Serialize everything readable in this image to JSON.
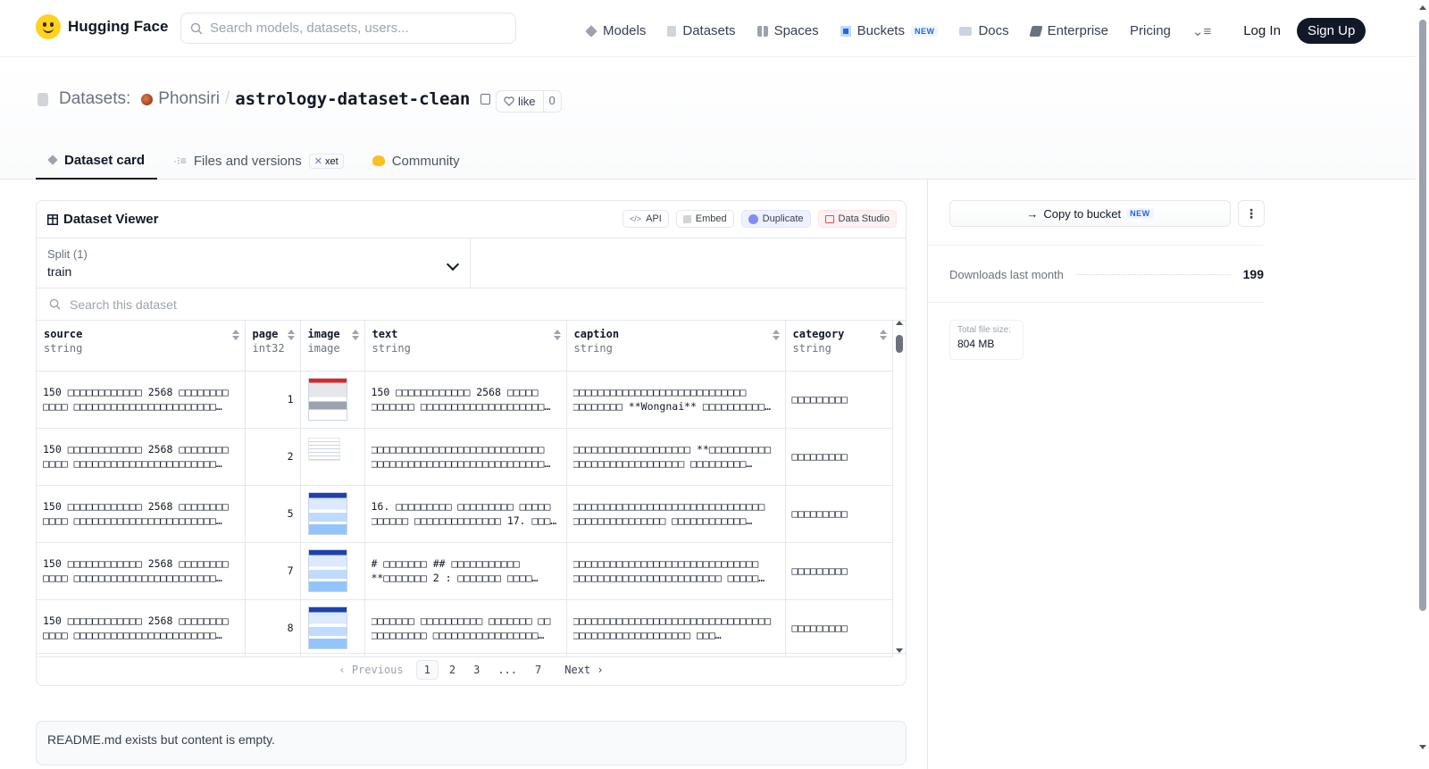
{
  "nav": {
    "brand": "Hugging Face",
    "search_placeholder": "Search models, datasets, users...",
    "links": [
      {
        "label": "Models",
        "icon": "models-icon",
        "color": "#9ca3af"
      },
      {
        "label": "Datasets",
        "icon": "datasets-icon",
        "color": "#d1d5db"
      },
      {
        "label": "Spaces",
        "icon": "spaces-icon",
        "color": "#9ca3af"
      },
      {
        "label": "Buckets",
        "icon": "buckets-icon",
        "color": "#2563eb",
        "badge": "NEW"
      },
      {
        "label": "Docs",
        "icon": "docs-icon",
        "color": "#9ca3af"
      },
      {
        "label": "Enterprise",
        "icon": "enterprise-icon",
        "color": "#6b7280"
      },
      {
        "label": "Pricing"
      }
    ],
    "login": "Log In",
    "signup": "Sign Up"
  },
  "header": {
    "prefix": "Datasets:",
    "user": "Phonsiri",
    "separator": "/",
    "repo": "astrology-dataset-clean",
    "like_label": "like",
    "like_count": "0",
    "tabs": [
      {
        "label": "Dataset card",
        "active": true
      },
      {
        "label": "Files and versions",
        "tag": "xet"
      },
      {
        "label": "Community"
      }
    ]
  },
  "viewer": {
    "title": "Dataset Viewer",
    "buttons": {
      "api": "API",
      "embed": "Embed",
      "duplicate": "Duplicate",
      "studio": "Data Studio"
    },
    "split_label": "Split (1)",
    "split_value": "train",
    "search_placeholder": "Search this dataset",
    "columns": [
      {
        "name": "source",
        "type": "string"
      },
      {
        "name": "page",
        "type": "int32"
      },
      {
        "name": "image",
        "type": "image"
      },
      {
        "name": "text",
        "type": "string"
      },
      {
        "name": "caption",
        "type": "string"
      },
      {
        "name": "category",
        "type": "string"
      }
    ],
    "rows": [
      {
        "source": "150 □□□□□□□□□□□□ 2568 □□□□□□□□ □□□□ □□□□□□□□□□□□□□□□□□□□□□□…",
        "page": "1",
        "image_style": "red",
        "text": "150 □□□□□□□□□□□□ 2568 □□□□□ □□□□□□□ □□□□□□□□□□□□□□□□□□□□…",
        "caption": "□□□□□□□□□□□□□□□□□□□□□□□□□□□□ □□□□□□□□ **Wongnai** □□□□□□□□□□…",
        "category": "□□□□□□□□□"
      },
      {
        "source": "150 □□□□□□□□□□□□ 2568 □□□□□□□□ □□□□ □□□□□□□□□□□□□□□□□□□□□□□…",
        "page": "2",
        "image_style": "doc",
        "text": "□□□□□□□□□□□□□□□□□□□□□□□□□□□□ □□□□□□□□□□□□□□□□□□□□□□□□□□□□…",
        "caption": "□□□□□□□□□□□□□□□□□□□ **□□□□□□□□□□ □□□□□□□□□□□□□□□□□□ □□□□□□□□□…",
        "category": "□□□□□□□□□"
      },
      {
        "source": "150 □□□□□□□□□□□□ 2568 □□□□□□□□ □□□□ □□□□□□□□□□□□□□□□□□□□□□□…",
        "page": "5",
        "image_style": "blue",
        "text": "16. □□□□□□□□□ □□□□□□□□□ □□□□□ □□□□□□ □□□□□□□□□□□□□□ 17. □□□…",
        "caption": "□□□□□□□□□□□□□□□□□□□□□□□□□□□□□□□ □□□□□□□□□□□□□□□ □□□□□□□□□□□□…",
        "category": "□□□□□□□□□"
      },
      {
        "source": "150 □□□□□□□□□□□□ 2568 □□□□□□□□ □□□□ □□□□□□□□□□□□□□□□□□□□□□□…",
        "page": "7",
        "image_style": "blue",
        "text": "# □□□□□□□ ## □□□□□□□□□□□ **□□□□□□□ 2 : □□□□□□□ □□□□…",
        "caption": "□□□□□□□□□□□□□□□□□□□□□□□□□□□□□□ □□□□□□□□□□□□□□□□□□□□□□□□ □□□□□…",
        "category": "□□□□□□□□□"
      },
      {
        "source": "150 □□□□□□□□□□□□ 2568 □□□□□□□□ □□□□ □□□□□□□□□□□□□□□□□□□□□□□…",
        "page": "8",
        "image_style": "blue",
        "text": "□□□□□□□ □□□□□□□□□□ □□□□□□□ □□ □□□□□□□□□ □□□□□□□□□□□□□□□□□…",
        "caption": "□□□□□□□□□□□□□□□□□□□□□□□□□□□□□□□□ □□□□□□□□□□□□□□□□□□□ □□□…",
        "category": "□□□□□□□□□"
      }
    ],
    "pager": {
      "prev": "Previous",
      "pages": [
        "1",
        "2",
        "3",
        "...",
        "7"
      ],
      "current": "1",
      "next": "Next"
    }
  },
  "readme_notice": "README.md exists but content is empty.",
  "sidebar": {
    "copy_bucket": "Copy to bucket",
    "copy_bucket_badge": "NEW",
    "downloads_label": "Downloads last month",
    "downloads_value": "199",
    "filesize_label": "Total file size:",
    "filesize_value": "804 MB"
  }
}
